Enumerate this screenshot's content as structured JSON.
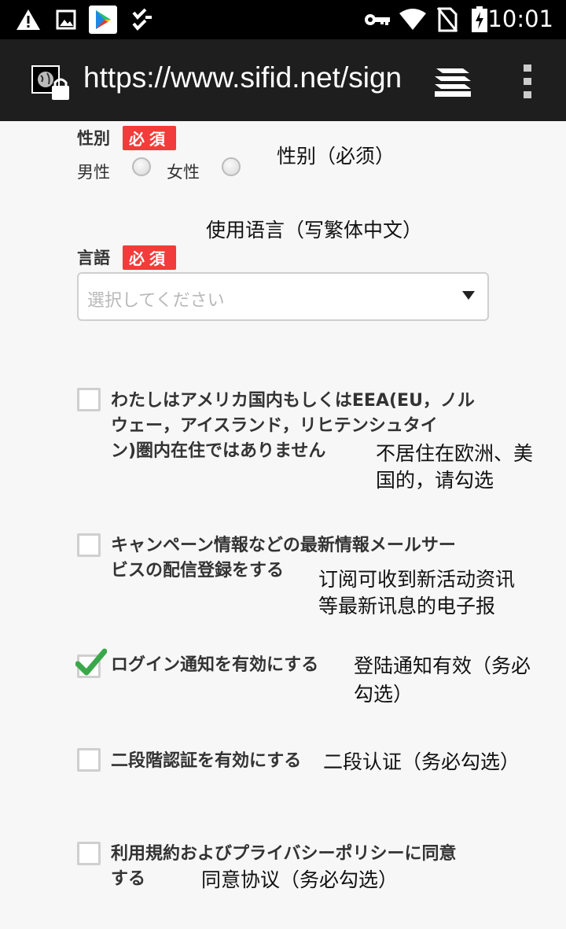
{
  "status_bar": {
    "time": "10:01",
    "left_icons": [
      "warning-icon",
      "image-icon",
      "play-store-icon",
      "checklist-icon"
    ],
    "right_icons": [
      "key-icon",
      "wifi-icon",
      "no-sim-icon",
      "battery-charging-icon"
    ]
  },
  "url_bar": {
    "url": "https://www.sifid.net/signup",
    "icons": [
      "site-lock-icon",
      "tabs-icon",
      "menu-icon"
    ]
  },
  "form": {
    "gender": {
      "label": "性別",
      "required": "必須",
      "options": [
        "男性",
        "女性"
      ],
      "note": "性别（必须）"
    },
    "language": {
      "note": "使用语言（写繁体中文）",
      "label": "言語",
      "required": "必須",
      "placeholder": "選択してください"
    },
    "checkboxes": [
      {
        "line1": "わたしはアメリカ国内もしくはEEA(EU，ノル",
        "line2": "ウェー，アイスランド，リヒテンシュタイ",
        "line3": "ン)圏内在住ではありません",
        "note1": "不居住在欧洲、美",
        "note2": "国的，请勾选",
        "checked": false
      },
      {
        "line1": "キャンペーン情報などの最新情報メールサー",
        "line2": "ビスの配信登録をする",
        "note1": "订阅可收到新活动资讯",
        "note2": "等最新讯息的电子报",
        "checked": false
      },
      {
        "line1": "ログイン通知を有効にする",
        "note1": "登陆通知有效（务必",
        "note2": "勾选）",
        "checked": true
      },
      {
        "line1": "二段階認証を有効にする",
        "note1": "二段认证（务必勾选）",
        "checked": false
      },
      {
        "line1": "利用規約およびプライバシーポリシーに同意",
        "line2": "する",
        "note1": "同意协议（务必勾选）",
        "checked": false
      }
    ]
  },
  "colors": {
    "required_badge": "#f23b3b",
    "check_mark": "#3aa84a",
    "url_bar_bg": "#1e1e1e"
  }
}
